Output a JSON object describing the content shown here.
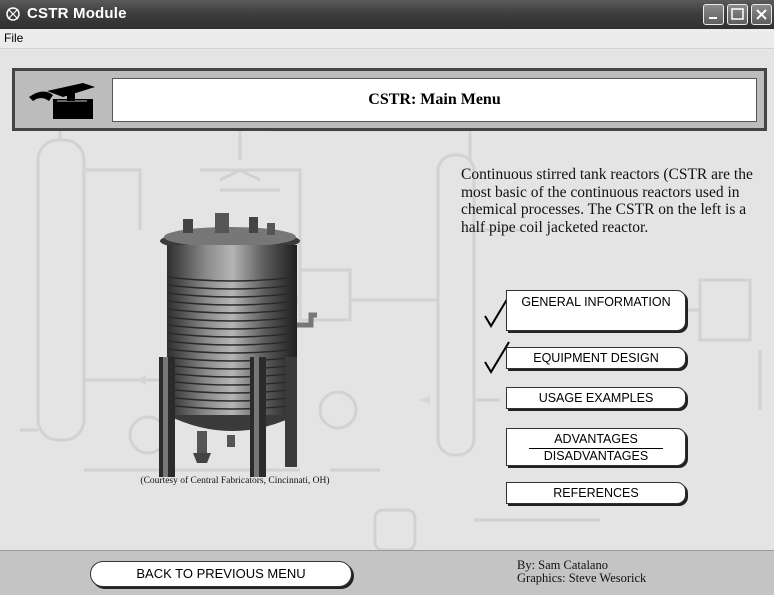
{
  "window": {
    "title": "CSTR Module"
  },
  "menubar": {
    "file": "File"
  },
  "header": {
    "title": "CSTR: Main Menu"
  },
  "reactor": {
    "caption": "(Courtesy of Central Fabricators, Cincinnati, OH)"
  },
  "description": "Continuous stirred tank reactors (CSTR are the most basic of the continuous reactors used in chemical processes. The CSTR on the left is a half pipe coil jacketed reactor.",
  "menu": {
    "general_information": "GENERAL INFORMATION",
    "equipment_design": "EQUIPMENT DESIGN",
    "usage_examples": "USAGE EXAMPLES",
    "advantages": "ADVANTAGES",
    "disadvantages": "DISADVANTAGES",
    "references": "REFERENCES"
  },
  "visited": {
    "general_information": true,
    "equipment_design": true
  },
  "footer": {
    "back_label": "BACK TO PREVIOUS MENU",
    "author": "By: Sam Catalano",
    "graphics": "Graphics: Steve Wesorick"
  },
  "icons": {
    "app": "valve-icon",
    "header": "reactor-logo-icon",
    "check": "checkmark-icon"
  },
  "colors": {
    "titlebar": "#3f3f3f",
    "header_bg": "#bcbcbc",
    "content_bg": "#e4e4e4",
    "footer_bg": "#c4c4c4"
  }
}
